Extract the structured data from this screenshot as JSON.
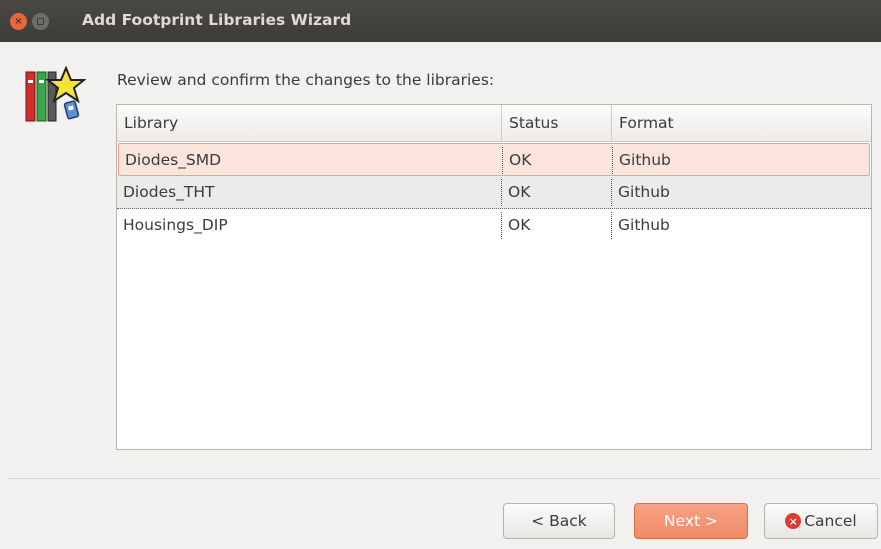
{
  "window": {
    "title": "Add Footprint Libraries Wizard",
    "close_glyph": "×",
    "icon": "library-star-icon"
  },
  "main": {
    "prompt": "Review and confirm the changes to the libraries:",
    "table": {
      "columns": [
        "Library",
        "Status",
        "Format"
      ],
      "rows": [
        {
          "library": "Diodes_SMD",
          "status": "OK",
          "format": "Github",
          "selected": true
        },
        {
          "library": "Diodes_THT",
          "status": "OK",
          "format": "Github",
          "selected": false
        },
        {
          "library": "Housings_DIP",
          "status": "OK",
          "format": "Github",
          "selected": false
        }
      ]
    }
  },
  "buttons": {
    "back": "< Back",
    "next": "Next >",
    "cancel": "Cancel",
    "cancel_glyph": "×"
  },
  "colors": {
    "accent": "#f08a66",
    "selection": "#fbe4dc",
    "titlebar": "#3c3b37"
  }
}
